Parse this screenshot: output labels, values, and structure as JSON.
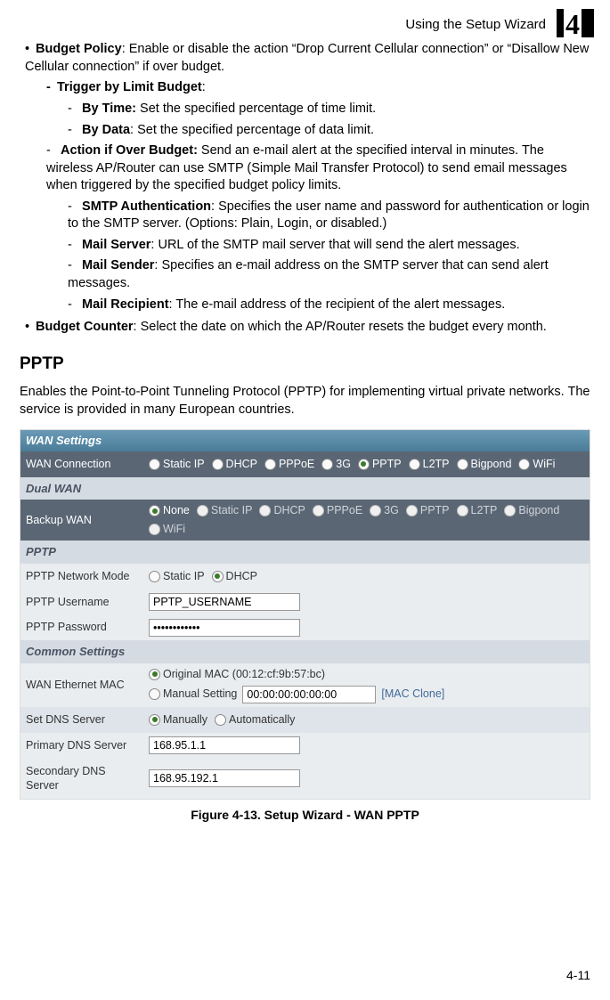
{
  "header": {
    "title": "Using the Setup Wizard",
    "chapter": "4"
  },
  "content": {
    "budget_policy": {
      "title": "Budget Policy",
      "text": ": Enable or disable the action “Drop Current Cellular connection” or “Disallow New Cellular connection” if over budget.",
      "trigger": {
        "title": "Trigger by Limit Budget",
        "colon": ":",
        "by_time_label": "By Time:",
        "by_time_text": " Set the specified percentage of time limit.",
        "by_data_label": "By Data",
        "by_data_text": ": Set the specified percentage of data limit."
      },
      "action": {
        "label": "Action if Over Budget:",
        "text": " Send an e-mail alert at the specified interval in minutes. The wireless AP/Router can use SMTP (Simple Mail Transfer Protocol) to send email messages when triggered by the specified budget policy limits.",
        "smtp_auth_label": "SMTP Authentication",
        "smtp_auth_text": ": Specifies the user name and password for authentication or login to the SMTP server. (Options: Plain, Login, or disabled.)",
        "mail_server_label": "Mail Server",
        "mail_server_text": ": URL of the SMTP mail server that will send the alert messages.",
        "mail_sender_label": "Mail Sender",
        "mail_sender_text": ": Specifies an e-mail address on the SMTP server that can send alert messages.",
        "mail_recipient_label": "Mail Recipient",
        "mail_recipient_text": ": The e-mail address of the recipient of the alert messages."
      }
    },
    "budget_counter": {
      "label": "Budget Counter",
      "text": ": Select the date on which the AP/Router resets the budget every month."
    },
    "section_heading": "PPTP",
    "intro": "Enables the Point-to-Point Tunneling Protocol (PPTP) for implementing virtual private networks. The service is provided in many European countries."
  },
  "figure": {
    "title": "WAN Settings",
    "wan_conn": {
      "label": "WAN Connection",
      "options": [
        "Static IP",
        "DHCP",
        "PPPoE",
        "3G",
        "PPTP",
        "L2TP",
        "Bigpond",
        "WiFi"
      ],
      "selected": "PPTP"
    },
    "dual_wan_header": "Dual WAN",
    "backup_wan": {
      "label": "Backup WAN",
      "options": [
        "None",
        "Static IP",
        "DHCP",
        "PPPoE",
        "3G",
        "PPTP",
        "L2TP",
        "Bigpond",
        "WiFi"
      ],
      "selected": "None"
    },
    "pptp_header": "PPTP",
    "pptp_mode": {
      "label": "PPTP Network Mode",
      "options": [
        "Static IP",
        "DHCP"
      ],
      "selected": "DHCP"
    },
    "pptp_user": {
      "label": "PPTP Username",
      "value": "PPTP_USERNAME"
    },
    "pptp_pass": {
      "label": "PPTP Password",
      "value": "••••••••••••"
    },
    "common_header": "Common Settings",
    "mac": {
      "label": "WAN Ethernet MAC",
      "original_prefix": "Original MAC (",
      "original_value": "00:12:cf:9b:57:bc",
      "original_suffix": ")",
      "manual_label": "Manual Setting",
      "manual_value": "00:00:00:00:00:00",
      "clone": "[MAC Clone]",
      "selected": "Original"
    },
    "dns": {
      "label": "Set DNS Server",
      "options": [
        "Manually",
        "Automatically"
      ],
      "selected": "Manually"
    },
    "pri_dns": {
      "label": "Primary DNS Server",
      "value": "168.95.1.1"
    },
    "sec_dns": {
      "label": "Secondary DNS Server",
      "value": "168.95.192.1"
    },
    "caption": "Figure 4-13.   Setup Wizard - WAN PPTP"
  },
  "page_num": "4-11"
}
